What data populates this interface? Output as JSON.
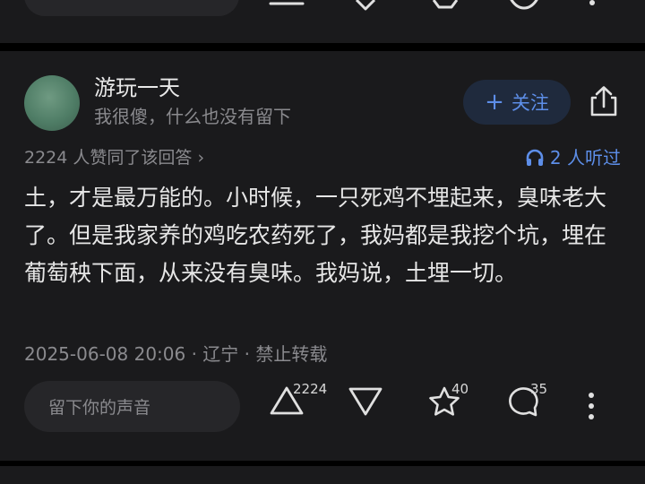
{
  "answer": {
    "author": {
      "name": "游玩一天",
      "bio": "我很傻，什么也没有留下"
    },
    "follow_label": "关注",
    "upvote_summary": "2224 人赞同了该回答",
    "listen_label": "2 人听过",
    "content": "土，才是最万能的。小时候，一只死鸡不埋起来，臭味老大了。但是我家养的鸡吃农药死了，我妈都是我挖个坑，埋在葡萄秧下面，从来没有臭味。我妈说，土埋一切。",
    "meta": "2025-06-08 20:06 · 辽宁 · 禁止转载"
  },
  "actions": {
    "comment_placeholder": "留下你的声音",
    "upvote_count": "2224",
    "favorite_count": "40",
    "comment_count": "35"
  },
  "colors": {
    "background": "#000000",
    "card": "#1a1a1c",
    "accent": "#5d8ee8",
    "text_primary": "#e6e6e6",
    "text_secondary": "#8a8a8e"
  }
}
